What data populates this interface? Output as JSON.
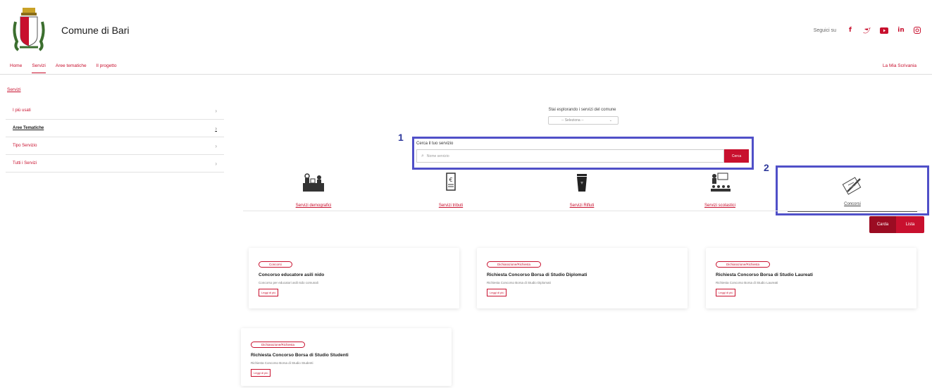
{
  "header": {
    "site_title": "Comune di Bari",
    "follow_label": "Seguici su",
    "social": [
      {
        "icon": "facebook-icon",
        "glyph": "f"
      },
      {
        "icon": "twitter-icon",
        "glyph": "🐦"
      },
      {
        "icon": "youtube-icon",
        "glyph": "▶"
      },
      {
        "icon": "linkedin-icon",
        "glyph": "in"
      },
      {
        "icon": "instagram-icon",
        "glyph": "◎"
      }
    ]
  },
  "nav": {
    "items": [
      "Home",
      "Servizi",
      "Aree tematiche",
      "Il progetto"
    ],
    "active": "Servizi",
    "right_link": "La Mia Scrivania"
  },
  "breadcrumb": "Servizi",
  "sidebar": {
    "items": [
      {
        "label": "I più usati"
      },
      {
        "label": "Aree Tematiche"
      },
      {
        "label": "Tipo Servizio"
      },
      {
        "label": "Tutti i Servizi"
      }
    ]
  },
  "explore": {
    "label": "Stai esplorando i servizi del comune",
    "select_value": "-- Seleziona --"
  },
  "search": {
    "marker": "1",
    "label": "Cerca il tuo servizio",
    "placeholder": "Nome servizio",
    "button": "Cerca"
  },
  "categories": {
    "marker": "2",
    "items": [
      {
        "label": "Servizi demografici",
        "icon": "demographic-services-icon"
      },
      {
        "label": "Servizi tributi",
        "icon": "tax-services-icon"
      },
      {
        "label": "Servizi Rifiuti",
        "icon": "waste-bin-icon"
      },
      {
        "label": "Servizi scolastici",
        "icon": "school-class-icon"
      },
      {
        "label": "Concorsi",
        "icon": "contest-pencil-icon"
      }
    ]
  },
  "view_toggle": {
    "card": "Carda",
    "list": "Lista"
  },
  "cards": [
    {
      "badge": "Concorsi",
      "title": "Concorso educatore asili nido",
      "desc": "Concorso per educatori asili nido comunali",
      "more": "Leggi di più"
    },
    {
      "badge": "Dichiarazione/Richiesta",
      "title": "Richiesta Concorso Borsa di Studio Diplomati",
      "desc": "Richiesta Concorso Borsa di Studio Diplomati",
      "more": "Leggi di più"
    },
    {
      "badge": "Dichiarazione/Richiesta",
      "title": "Richiesta Concorso Borsa di Studio Laureati",
      "desc": "Richiesta Concorso Borsa di Studio Laureati",
      "more": "Leggi di più"
    },
    {
      "badge": "Dichiarazione/Richiesta",
      "title": "Richiesta Concorso Borsa di Studio Studenti",
      "desc": "Richiesta Concorso Borsa di Studio Studenti",
      "more": "Leggi di più"
    }
  ],
  "colors": {
    "brand": "#c8102e",
    "highlight": "#5050c8"
  }
}
